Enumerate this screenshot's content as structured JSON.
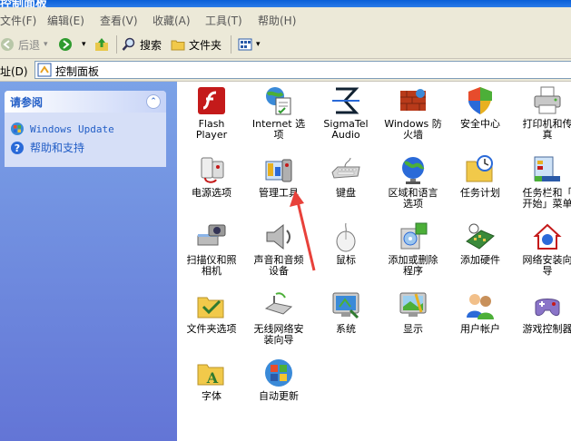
{
  "window": {
    "title": "控制面板"
  },
  "menu": [
    "文件(F)",
    "编辑(E)",
    "查看(V)",
    "收藏(A)",
    "工具(T)",
    "帮助(H)"
  ],
  "toolbar": {
    "back": "后退",
    "search": "搜索",
    "folders": "文件夹"
  },
  "address": {
    "label": "地址(D)",
    "value": "控制面板"
  },
  "sidebar": {
    "title": "请参阅",
    "links": [
      "Windows Update",
      "帮助和支持"
    ]
  },
  "items": [
    {
      "label": "Flash\nPlayer",
      "icon": "flash-icon"
    },
    {
      "label": "Internet 选\n项",
      "icon": "internet-options-icon"
    },
    {
      "label": "SigmaTel\nAudio",
      "icon": "sigmatel-audio-icon"
    },
    {
      "label": "Windows 防\n火墙",
      "icon": "firewall-icon"
    },
    {
      "label": "安全中心",
      "icon": "security-center-icon"
    },
    {
      "label": "打印机和传\n真",
      "icon": "printer-icon"
    },
    {
      "label": "电源选项",
      "icon": "power-options-icon"
    },
    {
      "label": "管理工具",
      "icon": "admin-tools-icon"
    },
    {
      "label": "键盘",
      "icon": "keyboard-icon"
    },
    {
      "label": "区域和语言\n选项",
      "icon": "region-language-icon"
    },
    {
      "label": "任务计划",
      "icon": "scheduled-tasks-icon"
    },
    {
      "label": "任务栏和「\n开始」菜单",
      "icon": "taskbar-start-icon"
    },
    {
      "label": "扫描仪和照\n相机",
      "icon": "scanner-camera-icon"
    },
    {
      "label": "声音和音频\n设备",
      "icon": "sound-icon"
    },
    {
      "label": "鼠标",
      "icon": "mouse-icon"
    },
    {
      "label": "添加或删除\n程序",
      "icon": "add-remove-icon"
    },
    {
      "label": "添加硬件",
      "icon": "add-hardware-icon"
    },
    {
      "label": "网络安装向\n导",
      "icon": "network-setup-icon"
    },
    {
      "label": "文件夹选项",
      "icon": "folder-options-icon"
    },
    {
      "label": "无线网络安\n装向导",
      "icon": "wireless-setup-icon"
    },
    {
      "label": "系统",
      "icon": "system-icon"
    },
    {
      "label": "显示",
      "icon": "display-icon"
    },
    {
      "label": "用户帐户",
      "icon": "user-accounts-icon"
    },
    {
      "label": "游戏控制器",
      "icon": "game-controllers-icon"
    },
    {
      "label": "字体",
      "icon": "fonts-icon"
    },
    {
      "label": "自动更新",
      "icon": "automatic-updates-icon"
    }
  ],
  "colors": {
    "accent": "#215dc6",
    "sidebar": "#6f8ee0",
    "arrow": "#e8413a"
  }
}
